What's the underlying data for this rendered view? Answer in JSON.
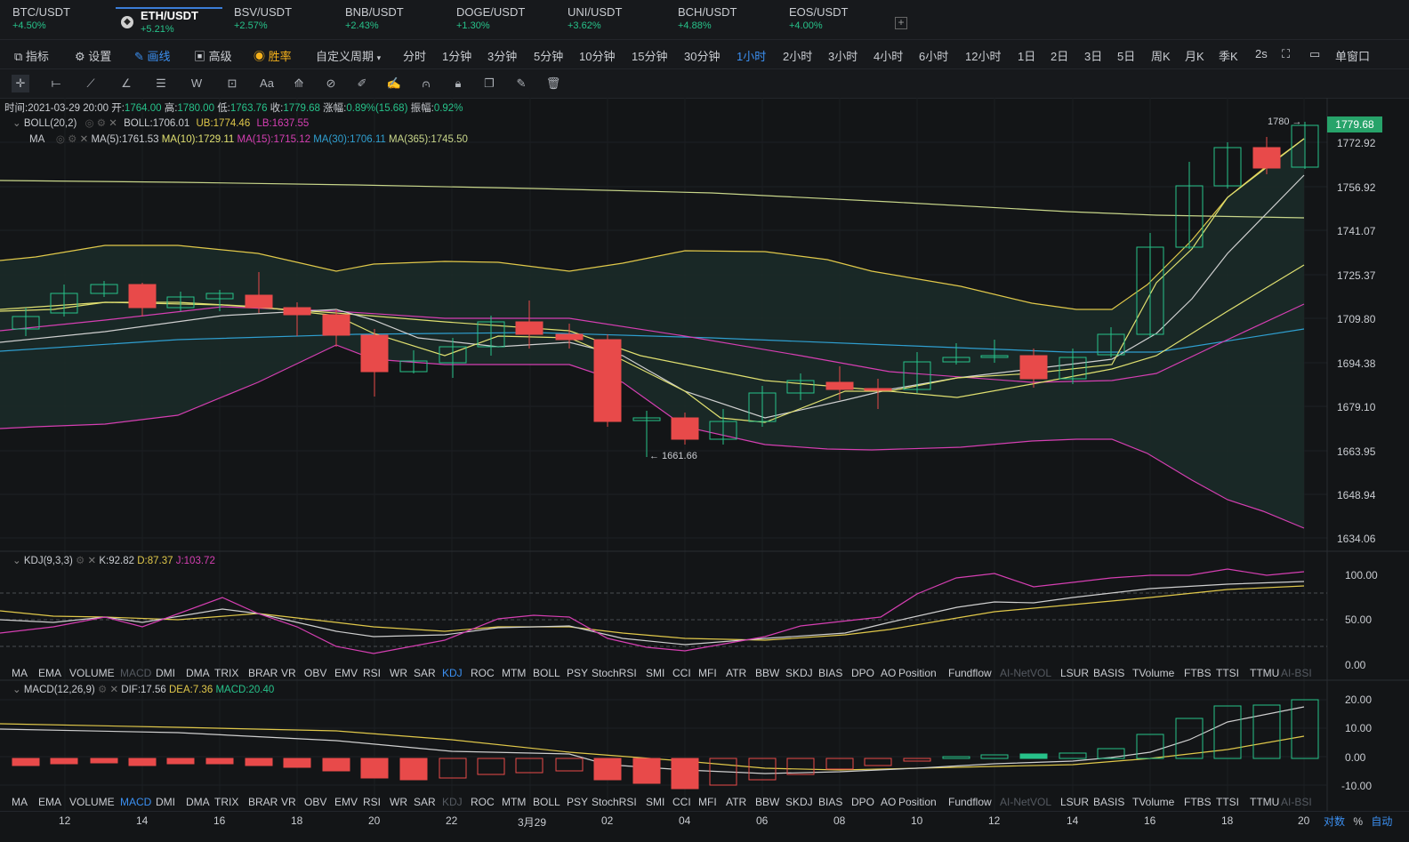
{
  "tabs": [
    {
      "name": "BTC/USDT",
      "change": "+4.50%"
    },
    {
      "name": "ETH/USDT",
      "change": "+5.21%"
    },
    {
      "name": "BSV/USDT",
      "change": "+2.57%"
    },
    {
      "name": "BNB/USDT",
      "change": "+2.43%"
    },
    {
      "name": "DOGE/USDT",
      "change": "+1.30%"
    },
    {
      "name": "UNI/USDT",
      "change": "+3.62%"
    },
    {
      "name": "BCH/USDT",
      "change": "+4.88%"
    },
    {
      "name": "EOS/USDT",
      "change": "+4.00%"
    }
  ],
  "toolbar": {
    "indicator": "指标",
    "settings": "设置",
    "draw": "画线",
    "advanced": "高级",
    "winrate": "胜率",
    "custom_period": "自定义周期",
    "periods": [
      "分时",
      "1分钟",
      "3分钟",
      "5分钟",
      "10分钟",
      "15分钟",
      "30分钟",
      "1小时",
      "2小时",
      "3小时",
      "4小时",
      "6小时",
      "12小时",
      "1日",
      "2日",
      "3日",
      "5日",
      "周K",
      "月K",
      "季K",
      "2s"
    ],
    "single_window": "单窗口"
  },
  "ohlc": {
    "time_label": "时间:",
    "time": "2021-03-29 20:00",
    "open_label": "开:",
    "open": "1764.00",
    "high_label": "高:",
    "high": "1780.00",
    "low_label": "低:",
    "low": "1763.76",
    "close_label": "收:",
    "close": "1779.68",
    "chg_label": "涨幅:",
    "chg": "0.89%(15.68)",
    "amp_label": "振幅:",
    "amp": "0.92%"
  },
  "boll": {
    "name": "BOLL(20,2)",
    "boll": "BOLL:1706.01",
    "ub": "UB:1774.46",
    "lb": "LB:1637.55"
  },
  "ma": {
    "name": "MA",
    "ma5": "MA(5):1761.53",
    "ma10": "MA(10):1729.11",
    "ma15": "MA(15):1715.12",
    "ma30": "MA(30):1706.11",
    "ma365": "MA(365):1745.50"
  },
  "price_axis": [
    "1772.92",
    "1756.92",
    "1741.07",
    "1725.37",
    "1709.80",
    "1694.38",
    "1679.10",
    "1663.95",
    "1648.94",
    "1634.06"
  ],
  "current_price": "1779.68",
  "high_marker": "1780",
  "low_marker": "← 1661.66",
  "kdj": {
    "name": "KDJ(9,3,3)",
    "k": "K:92.82",
    "d": "D:87.37",
    "j": "J:103.72",
    "axis": [
      "100.00",
      "50.00",
      "0.00"
    ]
  },
  "macd": {
    "name": "MACD(12,26,9)",
    "dif": "DIF:17.56",
    "dea": "DEA:7.36",
    "macd": "MACD:20.40",
    "axis": [
      "20.00",
      "10.00",
      "0.00",
      "-10.00"
    ]
  },
  "indicator_list": [
    "MA",
    "EMA",
    "VOLUME",
    "MACD",
    "DMI",
    "DMA",
    "TRIX",
    "BRAR",
    "VR",
    "OBV",
    "EMV",
    "RSI",
    "WR",
    "SAR",
    "KDJ",
    "ROC",
    "MTM",
    "BOLL",
    "PSY",
    "StochRSI",
    "SMI",
    "CCI",
    "MFI",
    "ATR",
    "BBW",
    "SKDJ",
    "BIAS",
    "DPO",
    "AO",
    "Position",
    "Fundflow",
    "AI-NetVOL",
    "LSUR",
    "BASIS",
    "TVolume",
    "FTBS",
    "TTSI",
    "TTMU",
    "AI-BSI"
  ],
  "time_axis": [
    "12",
    "14",
    "16",
    "18",
    "20",
    "22",
    "3月29",
    "02",
    "04",
    "06",
    "08",
    "10",
    "12",
    "14",
    "16",
    "18",
    "20"
  ],
  "bottom_right": {
    "log": "对数",
    "pct": "%",
    "auto": "自动"
  },
  "colors": {
    "up": "#27c28a",
    "down": "#e84a4a",
    "boll_mid": "#cfcfcf",
    "boll_band": "#e0c84a",
    "ma5": "#e0e070",
    "ma_pink": "#d53fb2",
    "ma_blue": "#2f9fd0",
    "ma365": "#c8d68a"
  }
}
